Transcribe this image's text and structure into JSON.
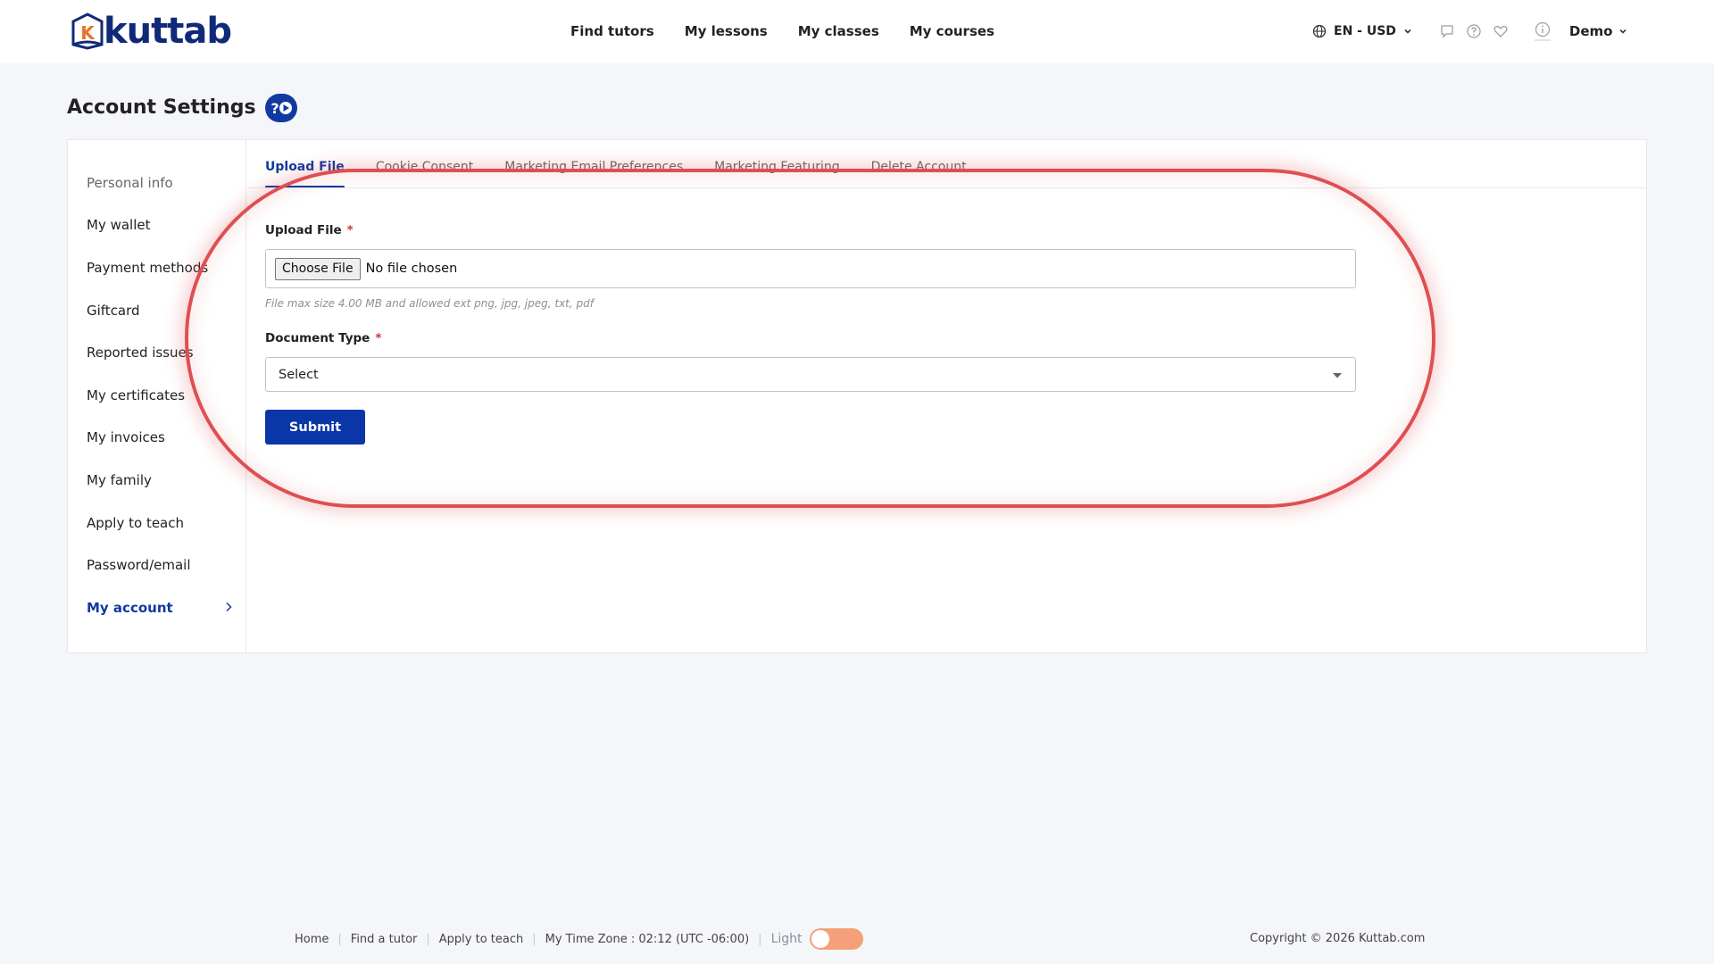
{
  "brand": {
    "name": "kuttab",
    "logo_letter": "K",
    "primary_color": "#103aa0"
  },
  "nav": {
    "items": [
      "Find tutors",
      "My lessons",
      "My classes",
      "My courses"
    ]
  },
  "header": {
    "locale": "EN - USD",
    "icons": [
      "chat-icon",
      "help-circle-icon",
      "heart-icon",
      "info-icon"
    ],
    "user": "Demo"
  },
  "page": {
    "title": "Account Settings"
  },
  "sidebar": {
    "items": [
      {
        "label": "Personal info"
      },
      {
        "label": "My wallet"
      },
      {
        "label": "Payment methods"
      },
      {
        "label": "Giftcard"
      },
      {
        "label": "Reported issues"
      },
      {
        "label": "My certificates"
      },
      {
        "label": "My invoices"
      },
      {
        "label": "My family"
      },
      {
        "label": "Apply to teach"
      },
      {
        "label": "Password/email"
      },
      {
        "label": "My account"
      }
    ],
    "active": "My account"
  },
  "tabs": {
    "items": [
      "Upload File",
      "Cookie Consent",
      "Marketing Email Preferences",
      "Marketing Featuring",
      "Delete Account"
    ],
    "active": "Upload File"
  },
  "form": {
    "upload_label": "Upload File",
    "required_mark": "*",
    "choose_file": "Choose File",
    "file_status": "No file chosen",
    "hint": "File max size 4.00 MB and allowed ext png, jpg, jpeg, txt, pdf",
    "doc_type_label": "Document Type",
    "doc_type_value": "Select",
    "submit": "Submit"
  },
  "footer": {
    "links": [
      "Home",
      "Find a tutor",
      "Apply to teach"
    ],
    "timezone": "My Time Zone : 02:12 (UTC -06:00)",
    "theme_label": "Light",
    "copyright": "Copyright © 2026 Kuttab.com"
  }
}
